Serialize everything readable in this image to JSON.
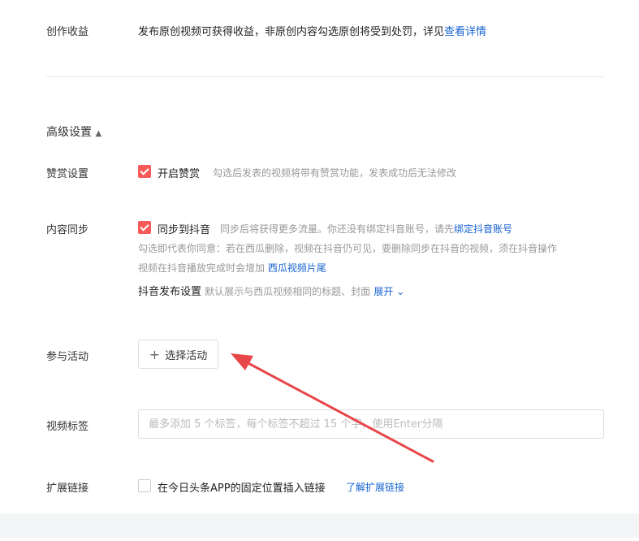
{
  "revenue": {
    "label": "创作收益",
    "text": "发布原创视频可获得收益，非原创内容勾选原创将受到处罚，详见",
    "link": "查看详情"
  },
  "advanced": {
    "title": "高级设置"
  },
  "reward": {
    "label": "赞赏设置",
    "option": "开启赞赏",
    "hint": "勾选后发表的视频将带有赞赏功能，发表成功后无法修改",
    "checked": true
  },
  "sync": {
    "label": "内容同步",
    "option": "同步到抖音",
    "hint": "同步后将获得更多流量。你还没有绑定抖音账号，请先",
    "hint_link": "绑定抖音账号",
    "note1": "勾选即代表你同意：若在西瓜删除，视频在抖音仍可见，要删除同步在抖音的视频，须在抖音操作",
    "note2": "视频在抖音播放完成时会增加",
    "note2_link": "西瓜视频片尾",
    "publish_label": "抖音发布设置",
    "publish_hint": "默认展示与西瓜视频相同的标题、封面",
    "expand": "展开",
    "checked": true
  },
  "activity": {
    "label": "参与活动",
    "button": "选择活动"
  },
  "tags": {
    "label": "视频标签",
    "placeholder": "最多添加 5 个标签，每个标签不超过 15 个字，使用Enter分隔",
    "value": ""
  },
  "ext": {
    "label": "扩展链接",
    "option": "在今日头条APP的固定位置插入链接",
    "link": "了解扩展链接",
    "checked": false
  },
  "colors": {
    "accent": "#f85959",
    "link": "#1462d1",
    "arrow": "#e8474a"
  }
}
